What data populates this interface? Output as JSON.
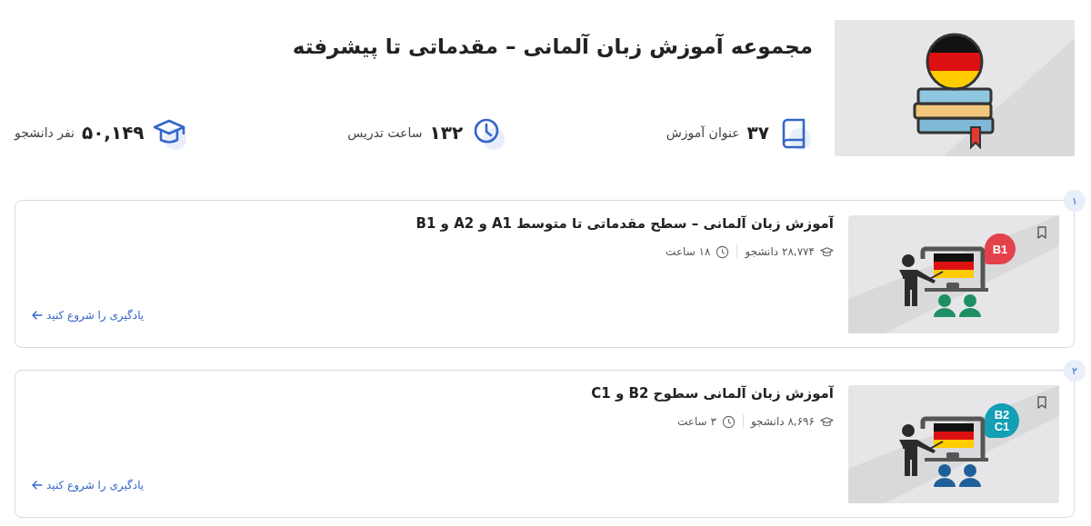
{
  "collection": {
    "title": "مجموعه آموزش زبان آلمانی – مقدماتی تا پیشرفته",
    "stats": [
      {
        "kind": "courses",
        "value": "۳۷",
        "label": "عنوان آموزش"
      },
      {
        "kind": "hours",
        "value": "۱۳۲",
        "label": "ساعت تدریس"
      },
      {
        "kind": "students",
        "value": "۵۰,۱۴۹",
        "label": "نفر دانشجو"
      }
    ]
  },
  "courses": [
    {
      "index": "۱",
      "title": "آموزش زبان آلمانی – سطح مقدماتی تا متوسط A1 و A2 و B1",
      "students": "۲۸,۷۷۴ دانشجو",
      "hours": "۱۸ ساعت",
      "link": "یادگیری را شروع کنید",
      "badge": {
        "lines": [
          "B1"
        ],
        "color": "#e5414b"
      },
      "illustration": {
        "color": "#1d8f63"
      }
    },
    {
      "index": "۲",
      "title": "آموزش زبان آلمانی سطوح B2 و C1",
      "students": "۸,۶۹۶ دانشجو",
      "hours": "۳ ساعت",
      "link": "یادگیری را شروع کنید",
      "badge": {
        "lines": [
          "B2",
          "C1"
        ],
        "color": "#139fb4"
      },
      "illustration": {
        "color": "#1f5f99"
      }
    }
  ]
}
